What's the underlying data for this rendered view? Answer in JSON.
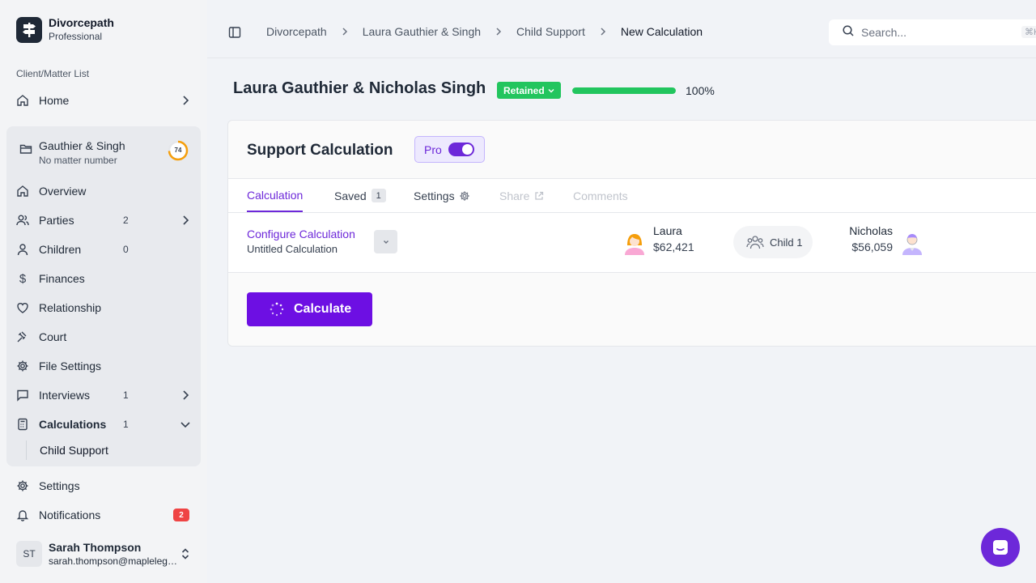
{
  "brand": {
    "name": "Divorcepath",
    "plan": "Professional"
  },
  "sidebar": {
    "section_label": "Client/Matter List",
    "home": "Home",
    "matter": {
      "title": "Gauthier & Singh",
      "subtitle": "No matter number",
      "progress": "74"
    },
    "items": [
      {
        "label": "Overview",
        "count": ""
      },
      {
        "label": "Parties",
        "count": "2"
      },
      {
        "label": "Children",
        "count": "0"
      },
      {
        "label": "Finances",
        "count": ""
      },
      {
        "label": "Relationship",
        "count": ""
      },
      {
        "label": "Court",
        "count": ""
      },
      {
        "label": "File Settings",
        "count": ""
      },
      {
        "label": "Interviews",
        "count": "1"
      },
      {
        "label": "Calculations",
        "count": "1"
      }
    ],
    "sub_item": "Child Support",
    "settings": "Settings",
    "notifications": {
      "label": "Notifications",
      "badge": "2"
    },
    "user": {
      "initials": "ST",
      "name": "Sarah Thompson",
      "email": "sarah.thompson@maplelegal.com"
    }
  },
  "topbar": {
    "breadcrumb": [
      "Divorcepath",
      "Laura Gauthier & Singh",
      "Child Support",
      "New Calculation"
    ],
    "search_placeholder": "Search...",
    "search_shortcut": "⌘K"
  },
  "case": {
    "title": "Laura Gauthier & Nicholas Singh",
    "status": "Retained",
    "progress_pct": 100,
    "progress_label": "100%"
  },
  "card": {
    "title": "Support Calculation",
    "pro_label": "Pro",
    "pro_enabled": true,
    "tabs": [
      {
        "label": "Calculation",
        "state": "active"
      },
      {
        "label": "Saved",
        "badge": "1",
        "state": "normal"
      },
      {
        "label": "Settings",
        "state": "normal"
      },
      {
        "label": "Share",
        "state": "disabled"
      },
      {
        "label": "Comments",
        "state": "disabled"
      }
    ],
    "config": {
      "title": "Configure Calculation",
      "subtitle": "Untitled Calculation"
    },
    "party1": {
      "name": "Laura",
      "income": "$62,421"
    },
    "child": "Child 1",
    "party2": {
      "name": "Nicholas",
      "income": "$56,059"
    },
    "calculate_label": "Calculate"
  },
  "colors": {
    "accent": "#6d28d9",
    "success": "#22c55e",
    "danger": "#ef4444"
  }
}
